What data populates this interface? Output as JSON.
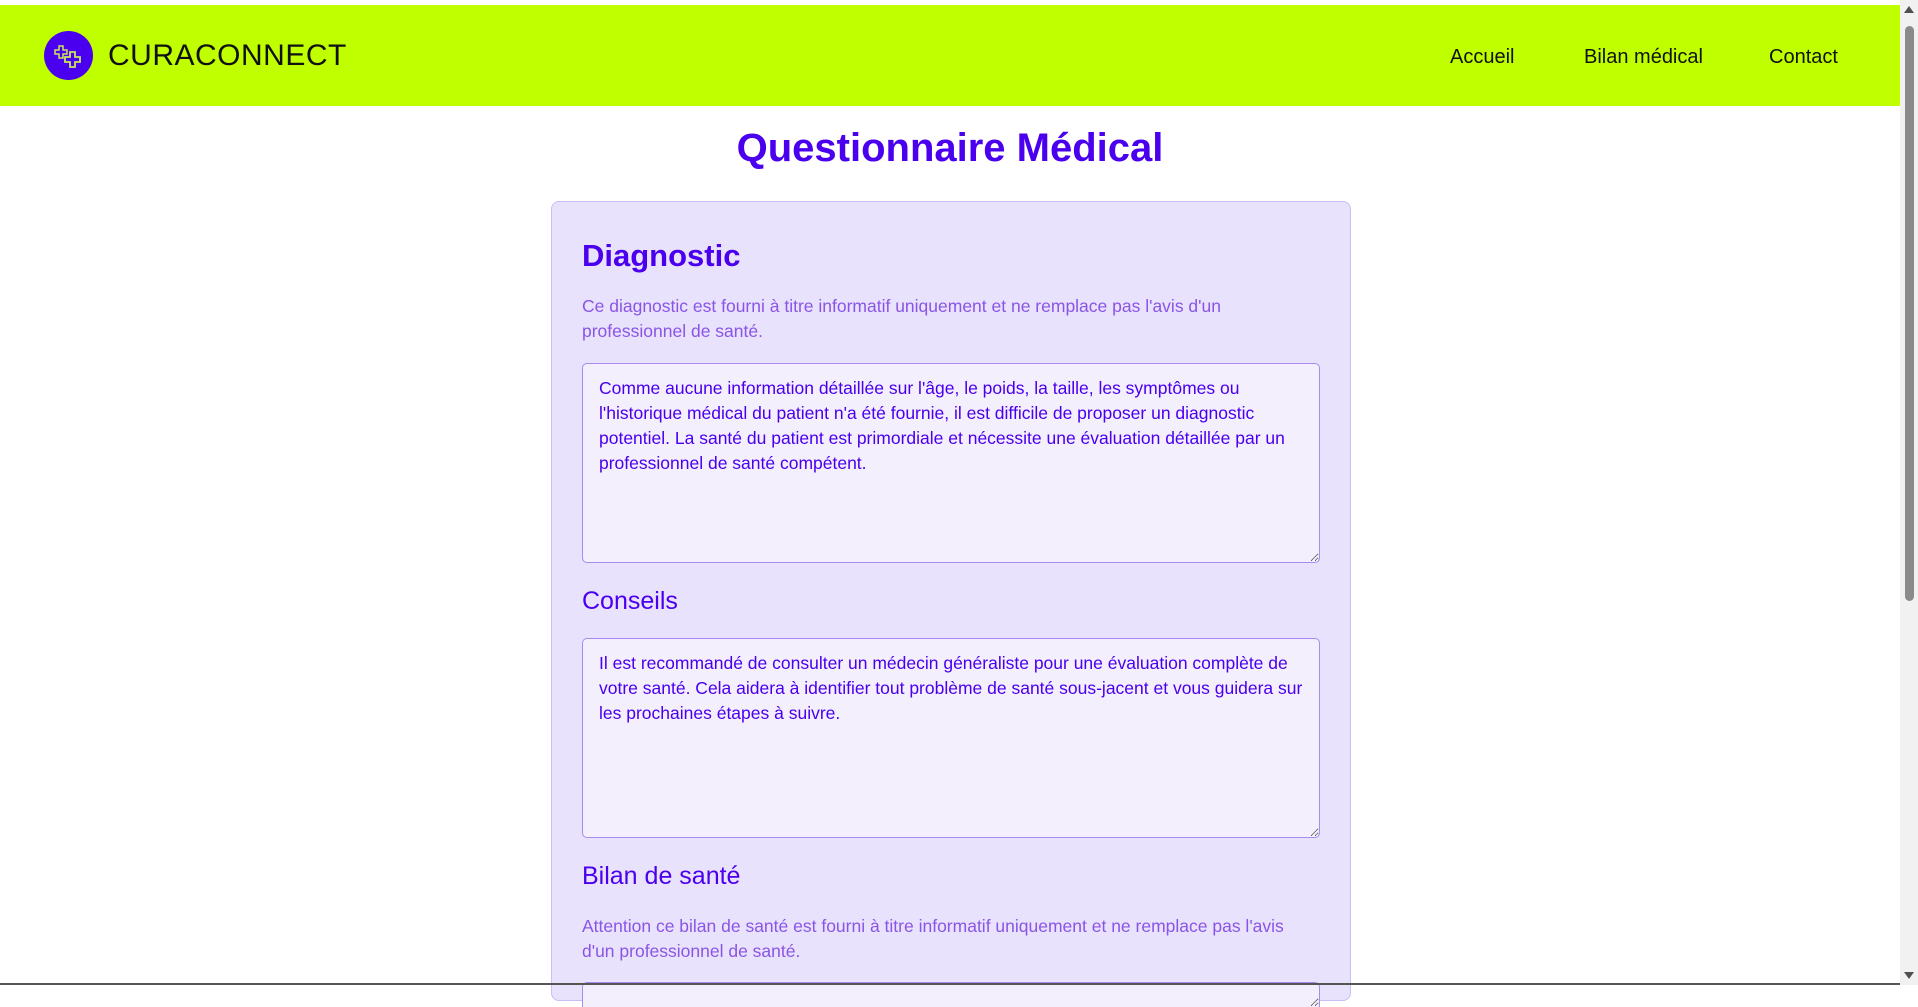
{
  "header": {
    "brand": "CURACONNECT",
    "logo_icon": "medical-crosses-icon",
    "nav": [
      "Accueil",
      "Bilan médical",
      "Contact"
    ],
    "background": "#bfff00"
  },
  "page_title": "Questionnaire Médical",
  "accent_color": "#4a00ee",
  "sections": {
    "diagnostic": {
      "title": "Diagnostic",
      "note": "Ce diagnostic est fourni à titre informatif uniquement et ne remplace pas l'avis d'un professionnel de santé.",
      "text": "Comme aucune information détaillée sur l'âge, le poids, la taille, les symptômes ou l'historique médical du patient n'a été fournie, il est difficile de proposer un diagnostic potentiel. La santé du patient est primordiale et nécessite une évaluation détaillée par un professionnel de santé compétent."
    },
    "conseils": {
      "title": "Conseils",
      "text": "Il est recommandé de consulter un médecin généraliste pour une évaluation complète de votre santé. Cela aidera à identifier tout problème de santé sous-jacent et vous guidera sur les prochaines étapes à suivre."
    },
    "bilan": {
      "title": "Bilan de santé",
      "note": "Attention ce bilan de santé est fourni à titre informatif uniquement et ne remplace pas l'avis d'un professionnel de santé."
    }
  }
}
